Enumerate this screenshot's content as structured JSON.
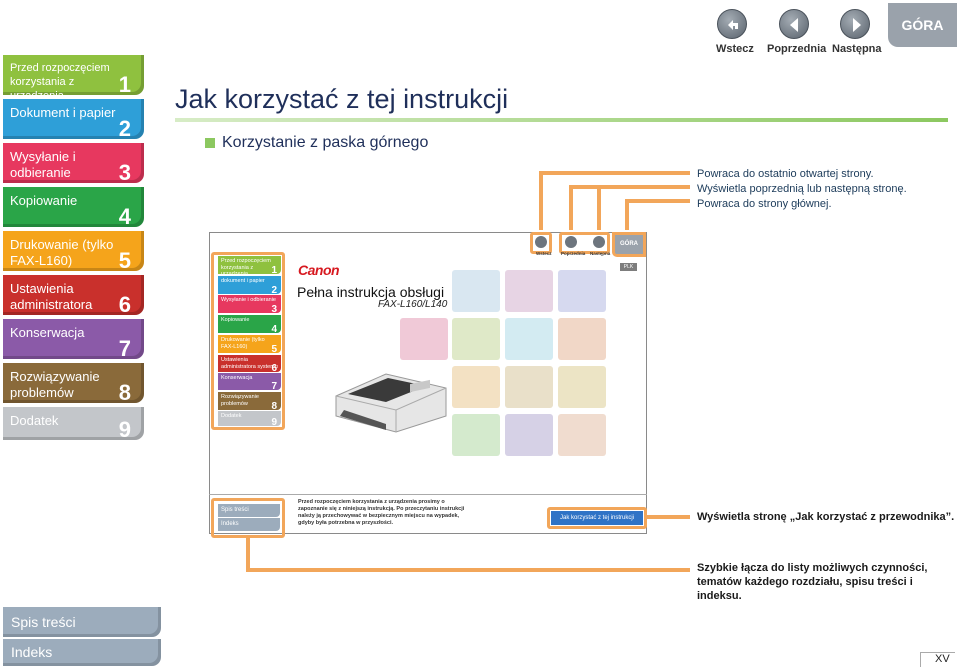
{
  "header": {
    "page_title": "Jak korzystać z tej instrukcji",
    "section_heading": "Korzystanie z paska górnego",
    "page_number": "XV"
  },
  "top_nav": {
    "back_label": "Wstecz",
    "prev_label": "Poprzednia",
    "next_label": "Następna",
    "top_label": "GÓRA",
    "back_icon": "back-arrow-icon",
    "prev_icon": "left-arrow-icon",
    "next_icon": "right-arrow-icon"
  },
  "sidebar": {
    "items": [
      {
        "label": "Przed rozpoczęciem korzystania z urządzenia",
        "num": "1",
        "color": "#8fc13f"
      },
      {
        "label": "Dokument i papier",
        "num": "2",
        "color": "#2e9fd8"
      },
      {
        "label": "Wysyłanie i odbieranie",
        "num": "3",
        "color": "#e7385f"
      },
      {
        "label": "Kopiowanie",
        "num": "4",
        "color": "#2aa548"
      },
      {
        "label": "Drukowanie (tylko FAX-L160)",
        "num": "5",
        "color": "#f5a41b"
      },
      {
        "label": "Ustawienia administratora systemu",
        "num": "6",
        "color": "#c9302c"
      },
      {
        "label": "Konserwacja",
        "num": "7",
        "color": "#8b5aa8"
      },
      {
        "label": "Rozwiązywanie problemów",
        "num": "8",
        "color": "#8a6a3a"
      },
      {
        "label": "Dodatek",
        "num": "9",
        "color": "#c3c6ca"
      }
    ],
    "toc_label": "Spis treści",
    "index_label": "Indeks"
  },
  "callouts": {
    "back": "Powraca do ostatnio otwartej strony.",
    "prev_next": "Wyświetla poprzednią lub następną stronę.",
    "top": "Powraca do strony głównej.",
    "how_to": "Wyświetla stronę „Jak korzystać z przewodnika”.",
    "sidebar": "Szybkie łącza do listy możliwych czynności, tematów każdego rozdziału, spisu treści i indeksu."
  },
  "preview": {
    "logo": "Canon",
    "manual_title": "Pełna instrukcja obsługi",
    "model": "FAX-L160/L140",
    "lang_badge": "PLK",
    "nav_back": "Wstecz",
    "nav_prev": "Poprzednia",
    "nav_next": "Następna",
    "nav_top": "GÓRA",
    "tabs": [
      {
        "label": "Przed rozpoczęciem korzystania z urządzenia",
        "num": "1"
      },
      {
        "label": "dokument i papier",
        "num": "2"
      },
      {
        "label": "Wysyłanie i odbieranie",
        "num": "3"
      },
      {
        "label": "Kopiowanie",
        "num": "4"
      },
      {
        "label": "Drukowanie (tylko FAX-L160)",
        "num": "5"
      },
      {
        "label": "Ustawienia administratora systemu",
        "num": "6"
      },
      {
        "label": "Konserwacja",
        "num": "7"
      },
      {
        "label": "Rozwiązywanie problemów",
        "num": "8"
      },
      {
        "label": "Dodatek",
        "num": "9"
      }
    ],
    "toc_label": "Spis treści",
    "index_label": "Indeks",
    "notice": "Przed rozpoczęciem korzystania z urządzenia prosimy o zapoznanie się z niniejszą instrukcją. Po przeczytaniu instrukcji należy ją przechowywać w bezpiecznym miejscu na wypadek, gdyby była potrzebna w przyszłości.",
    "how_to_button": "Jak korzystać z tej instrukcji"
  },
  "colors": {
    "highlight_orange": "#f2a65a",
    "title_rule": "#9ccf6e",
    "callout_text": "#1c3b5a"
  }
}
